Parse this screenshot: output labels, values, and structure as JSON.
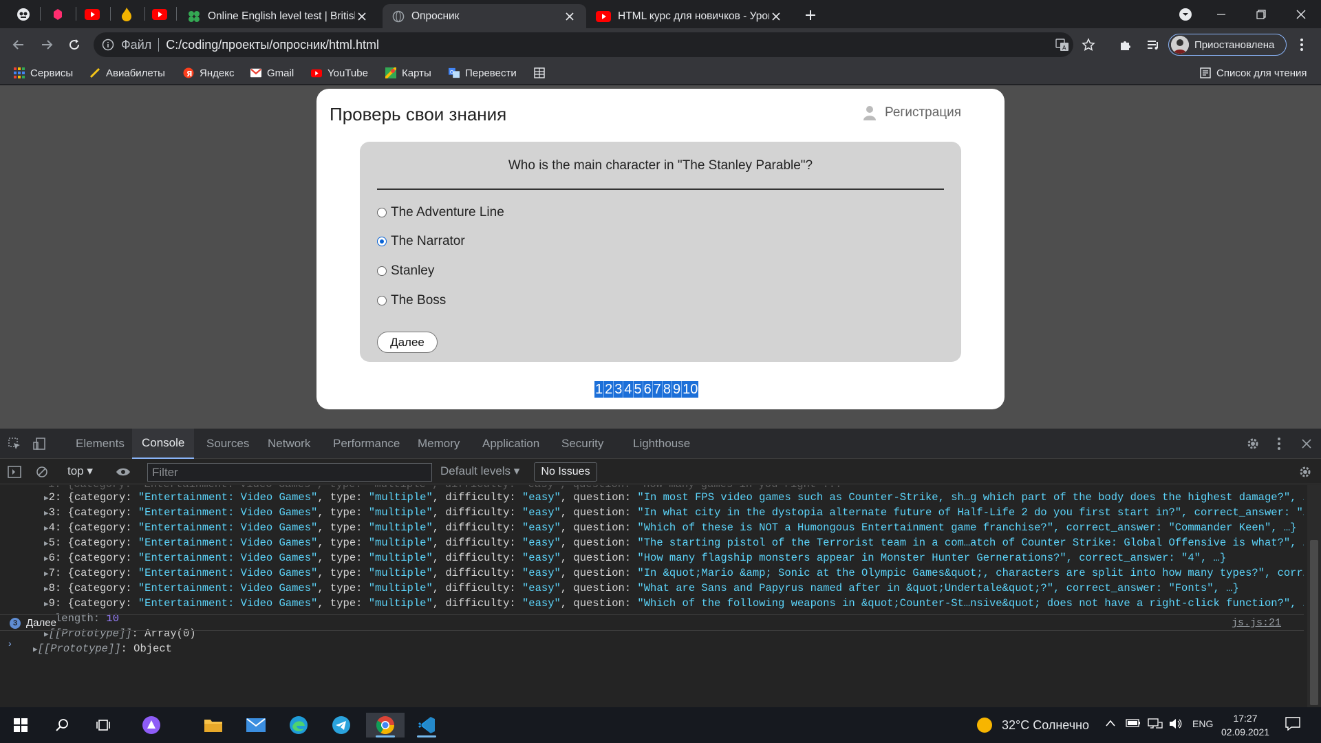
{
  "browser": {
    "tabs": [
      {
        "title": "Online English level test | British",
        "favicon": "clover-icon"
      },
      {
        "title": "Опросник",
        "favicon": "globe-icon",
        "active": true
      },
      {
        "title": "HTML курс для новичков - Урок",
        "favicon": "youtube-icon"
      }
    ],
    "omnibox": {
      "label": "Файл",
      "url": "C:/coding/проекты/опросник/html.html"
    },
    "profile": "Приостановлена",
    "bookmarks": [
      "Сервисы",
      "Авиабилеты",
      "Яндекс",
      "Gmail",
      "YouTube",
      "Карты",
      "Перевести"
    ],
    "reading_list": "Список для чтения"
  },
  "page": {
    "title": "Проверь свои знания",
    "register": "Регистрация",
    "question": "Who is the main character in \"The Stanley Parable\"?",
    "options": [
      {
        "label": "The Adventure Line",
        "checked": false
      },
      {
        "label": "The Narrator",
        "checked": true
      },
      {
        "label": "Stanley",
        "checked": false
      },
      {
        "label": "The Boss",
        "checked": false
      }
    ],
    "next_button": "Далее",
    "pages": [
      "1",
      "2",
      "3",
      "4",
      "5",
      "6",
      "7",
      "8",
      "9",
      "10"
    ]
  },
  "devtools": {
    "tabs": [
      "Elements",
      "Console",
      "Sources",
      "Network",
      "Performance",
      "Memory",
      "Application",
      "Security",
      "Lighthouse"
    ],
    "active_tab": "Console",
    "context": "top",
    "filter_placeholder": "Filter",
    "levels": "Default levels",
    "issues": "No Issues",
    "rows": [
      {
        "i": "2",
        "q": "\"In most FPS video games such as Counter-Strike, sh…g which part of the body does the highest damage?\", …"
      },
      {
        "i": "3",
        "q": "\"In what city in the dystopia alternate future of Half-Life 2 do you first start in?\", correct_answer: \"…"
      },
      {
        "i": "4",
        "q": "\"Which of these is NOT a Humongous Entertainment game franchise?\", correct_answer: \"Commander Keen\", …}"
      },
      {
        "i": "5",
        "q": "\"The starting pistol of the Terrorist team in a com…atch of Counter Strike: Global Offensive is what?\", …"
      },
      {
        "i": "6",
        "q": "\"How many flagship monsters appear in Monster Hunter Gernerations?\", correct_answer: \"4\", …}"
      },
      {
        "i": "7",
        "q": "\"In &quot;Mario &amp; Sonic at the Olympic Games&quot;, characters are split into how many types?\", corr…"
      },
      {
        "i": "8",
        "q": "\"What are Sans and Papyrus named after in &quot;Undertale&quot;?\", correct_answer: \"Fonts\", …}"
      },
      {
        "i": "9",
        "q": "\"Which of the following weapons in &quot;Counter-St…nsive&quot; does not have a right-click function?\", …"
      }
    ],
    "row_prefix": {
      "category": "\"Entertainment: Video Games\"",
      "type": "\"multiple\"",
      "difficulty": "\"easy\""
    },
    "length_label": "length",
    "length_value": "10",
    "proto_array": "[[Prototype]]",
    "proto_array_val": "Array(0)",
    "proto_object": "[[Prototype]]",
    "proto_object_val": "Object",
    "log_count": "3",
    "log_text": "Далее",
    "log_source": "js.js:21"
  },
  "taskbar": {
    "weather": "32°C  Солнечно",
    "lang": "ENG",
    "time": "17:27",
    "date": "02.09.2021"
  }
}
